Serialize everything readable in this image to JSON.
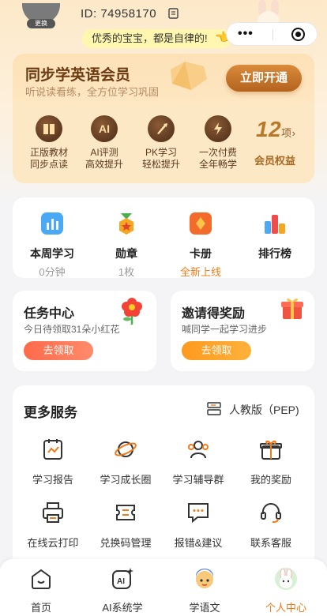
{
  "header": {
    "avatar_badge": "更换",
    "uid_text": "ID: 74958170",
    "slogan": "优秀的宝宝，都是自律的!"
  },
  "vip": {
    "title": "同步学英语会员",
    "subtitle": "听说读看练，全方位学习巩固",
    "cta": "立即开通",
    "benefits": [
      {
        "icon": "book-icon",
        "glyph": "",
        "l1": "正版教材",
        "l2": "同步点读"
      },
      {
        "icon": "ai-icon",
        "glyph": "AI",
        "l1": "AI评测",
        "l2": "高效提升"
      },
      {
        "icon": "rocket-icon",
        "glyph": "",
        "l1": "PK学习",
        "l2": "轻松提升"
      },
      {
        "icon": "bolt-shield-icon",
        "glyph": "",
        "l1": "一次付费",
        "l2": "全年畅学"
      }
    ],
    "count": "12",
    "count_unit": "项",
    "count_label": "会员权益"
  },
  "stats": [
    {
      "label": "本周学习",
      "value": "0分钟",
      "icon": "chart-icon"
    },
    {
      "label": "勋章",
      "value": "1枚",
      "icon": "medal-icon"
    },
    {
      "label": "卡册",
      "value": "全新上线",
      "icon": "card-icon"
    },
    {
      "label": "排行榜",
      "value": "",
      "icon": "leaderboard-icon"
    }
  ],
  "task": {
    "title": "任务中心",
    "subtitle": "今日待领取31朵小红花",
    "button": "去领取"
  },
  "invite": {
    "title": "邀请得奖励",
    "subtitle": "喊同学一起学习进步",
    "button": "去领取"
  },
  "services": {
    "title": "更多服务",
    "edition": "人教版（PEP)",
    "items": [
      {
        "label": "学习报告",
        "icon": "report-icon"
      },
      {
        "label": "学习成长圈",
        "icon": "planet-icon"
      },
      {
        "label": "学习辅导群",
        "icon": "group-icon"
      },
      {
        "label": "我的奖励",
        "icon": "gift-icon"
      },
      {
        "label": "在线云打印",
        "icon": "printer-icon"
      },
      {
        "label": "兑换码管理",
        "icon": "redeem-icon"
      },
      {
        "label": "报错&建议",
        "icon": "feedback-icon"
      },
      {
        "label": "联系客服",
        "icon": "headset-icon"
      }
    ]
  },
  "tabs": [
    {
      "label": "首页",
      "icon": "home-icon",
      "active": false
    },
    {
      "label": "AI系统学",
      "icon": "ai-tab-icon",
      "active": false
    },
    {
      "label": "学语文",
      "icon": "chinese-tab-icon",
      "active": false
    },
    {
      "label": "个人中心",
      "icon": "profile-tab-icon",
      "active": true
    }
  ],
  "colors": {
    "accent": "#f07b1a",
    "vip_brown": "#6b3a12",
    "task_red": "#ff6a4a",
    "invite_orange": "#ff9a1f"
  }
}
